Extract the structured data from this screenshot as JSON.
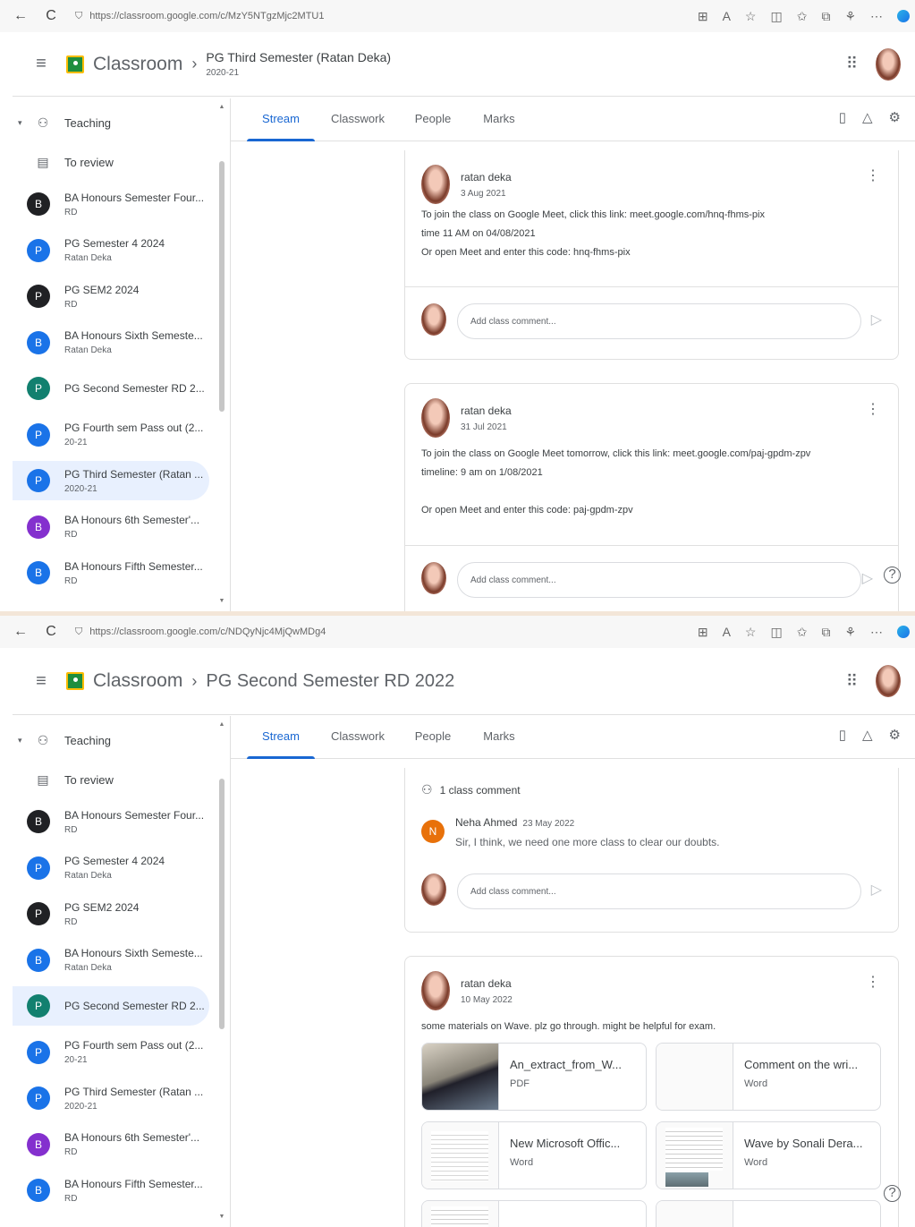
{
  "screen1": {
    "browser": {
      "url": "https://classroom.google.com/c/MzY5NTgzMjc2MTU1"
    },
    "header": {
      "brand": "Classroom",
      "class_title": "PG Third Semester (Ratan Deka)",
      "class_subtitle": "2020-21"
    },
    "sidebar": {
      "teaching_label": "Teaching",
      "to_review_label": "To review",
      "classes": [
        {
          "avatar": "B",
          "color": "#202124",
          "name": "BA Honours Semester Four...",
          "sub": "RD",
          "active": false
        },
        {
          "avatar": "P",
          "color": "#1a73e8",
          "name": "PG Semester 4 2024",
          "sub": "Ratan Deka",
          "active": false
        },
        {
          "avatar": "P",
          "color": "#202124",
          "name": "PG SEM2 2024",
          "sub": "RD",
          "active": false
        },
        {
          "avatar": "B",
          "color": "#1a73e8",
          "name": "BA Honours Sixth Semeste...",
          "sub": "Ratan Deka",
          "active": false
        },
        {
          "avatar": "P",
          "color": "#12806f",
          "name": "PG Second Semester RD 2...",
          "sub": "",
          "active": false
        },
        {
          "avatar": "P",
          "color": "#1a73e8",
          "name": "PG Fourth sem Pass out (2...",
          "sub": "20-21",
          "active": false
        },
        {
          "avatar": "P",
          "color": "#1a73e8",
          "name": "PG Third Semester (Ratan ...",
          "sub": "2020-21",
          "active": true
        },
        {
          "avatar": "B",
          "color": "#8430ce",
          "name": "BA Honours 6th Semester'...",
          "sub": "RD",
          "active": false
        },
        {
          "avatar": "B",
          "color": "#1a73e8",
          "name": "BA Honours Fifth Semester...",
          "sub": "RD",
          "active": false
        }
      ]
    },
    "tabs": [
      "Stream",
      "Classwork",
      "People",
      "Marks"
    ],
    "posts": [
      {
        "author": "ratan deka",
        "date": "3 Aug 2021",
        "lines": [
          "To join the class on Google Meet, click this link: meet.google.com/hnq-fhms-pix",
          "time 11 AM on 04/08/2021",
          "Or open Meet and enter this code: hnq-fhms-pix"
        ],
        "comment_placeholder": "Add class comment..."
      },
      {
        "author": "ratan deka",
        "date": "31 Jul 2021",
        "lines": [
          "To join the class on Google Meet tomorrow, click this link: meet.google.com/paj-gpdm-zpv",
          "timeline: 9 am on 1/08/2021",
          "",
          "Or open Meet and enter this code: paj-gpdm-zpv"
        ],
        "comment_placeholder": "Add class comment..."
      }
    ]
  },
  "screen2": {
    "browser": {
      "url": "https://classroom.google.com/c/NDQyNjc4MjQwMDg4"
    },
    "header": {
      "brand": "Classroom",
      "class_title": "PG Second Semester RD 2022"
    },
    "sidebar": {
      "teaching_label": "Teaching",
      "to_review_label": "To review",
      "classes": [
        {
          "avatar": "B",
          "color": "#202124",
          "name": "BA Honours Semester Four...",
          "sub": "RD",
          "active": false
        },
        {
          "avatar": "P",
          "color": "#1a73e8",
          "name": "PG Semester 4 2024",
          "sub": "Ratan Deka",
          "active": false
        },
        {
          "avatar": "P",
          "color": "#202124",
          "name": "PG SEM2 2024",
          "sub": "RD",
          "active": false
        },
        {
          "avatar": "B",
          "color": "#1a73e8",
          "name": "BA Honours Sixth Semeste...",
          "sub": "Ratan Deka",
          "active": false
        },
        {
          "avatar": "P",
          "color": "#12806f",
          "name": "PG Second Semester RD 2...",
          "sub": "",
          "active": true
        },
        {
          "avatar": "P",
          "color": "#1a73e8",
          "name": "PG Fourth sem Pass out (2...",
          "sub": "20-21",
          "active": false
        },
        {
          "avatar": "P",
          "color": "#1a73e8",
          "name": "PG Third Semester (Ratan ...",
          "sub": "2020-21",
          "active": false
        },
        {
          "avatar": "B",
          "color": "#8430ce",
          "name": "BA Honours 6th Semester'...",
          "sub": "RD",
          "active": false
        },
        {
          "avatar": "B",
          "color": "#1a73e8",
          "name": "BA Honours Fifth Semester...",
          "sub": "RD",
          "active": false
        }
      ]
    },
    "tabs": [
      "Stream",
      "Classwork",
      "People",
      "Marks"
    ],
    "comment_block": {
      "count_label": "1 class comment",
      "commenter_initial": "N",
      "commenter": "Neha Ahmed",
      "comment_date": "23 May 2022",
      "comment_text": "Sir, I think, we need one more class to clear our doubts.",
      "comment_placeholder": "Add class comment..."
    },
    "post": {
      "author": "ratan deka",
      "date": "10 May 2022",
      "text": "some materials on Wave. plz go through. might be helpful for exam.",
      "attachments": [
        {
          "title": "An_extract_from_W...",
          "kind": "PDF"
        },
        {
          "title": "Comment on the wri...",
          "kind": "Word"
        },
        {
          "title": "New Microsoft Offic...",
          "kind": "Word"
        },
        {
          "title": "Wave by Sonali Dera...",
          "kind": "Word"
        }
      ]
    }
  },
  "icons": {
    "back": "←",
    "reload": "C",
    "lock": "🔒",
    "hamburger": "≡",
    "chevron": "›",
    "apps": "⋮⋮⋮",
    "caret": "▾",
    "kebab": "⋮",
    "send": "▷",
    "help": "?",
    "calendar": "▭",
    "drive": "△",
    "settings": "⚙",
    "people": "👥",
    "review": "▤"
  },
  "colors": {
    "accent": "#1967d2",
    "active_bg": "#e8f0fe",
    "classroom_green": "#1e8e3e"
  }
}
